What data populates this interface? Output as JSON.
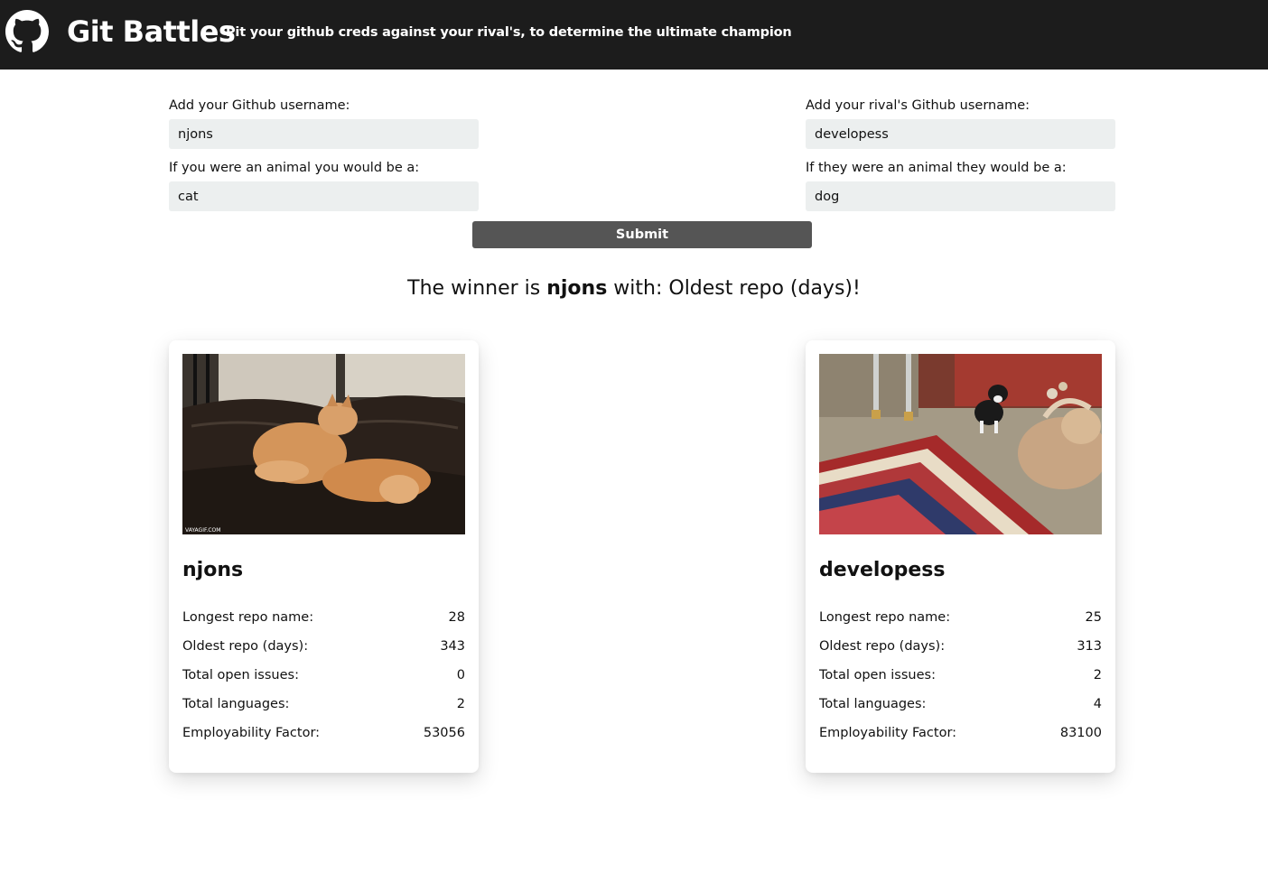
{
  "header": {
    "title": "Git Battles",
    "tagline": "Pit your github creds against your rival's, to determine the ultimate champion",
    "logo_icon": "github-octocat-icon"
  },
  "form": {
    "left": {
      "username_label": "Add your Github username:",
      "username_value": "njons",
      "animal_label": "If you were an animal you would be a:",
      "animal_value": "cat"
    },
    "right": {
      "username_label": "Add your rival's Github username:",
      "username_value": "developess",
      "animal_label": "If they were an animal they would be a:",
      "animal_value": "dog"
    },
    "submit_label": "Submit"
  },
  "result": {
    "prefix": "The winner is ",
    "winner": "njons",
    "middle": " with: ",
    "category": "Oldest repo (days)",
    "suffix": "!"
  },
  "cards": [
    {
      "name": "njons",
      "image_watermark": "VAYAGIF.COM",
      "stats": [
        {
          "label": "Longest repo name:",
          "value": "28"
        },
        {
          "label": "Oldest repo (days):",
          "value": "343"
        },
        {
          "label": "Total open issues:",
          "value": "0"
        },
        {
          "label": "Total languages:",
          "value": "2"
        },
        {
          "label": "Employability Factor:",
          "value": "53056"
        }
      ]
    },
    {
      "name": "developess",
      "stats": [
        {
          "label": "Longest repo name:",
          "value": "25"
        },
        {
          "label": "Oldest repo (days):",
          "value": "313"
        },
        {
          "label": "Total open issues:",
          "value": "2"
        },
        {
          "label": "Total languages:",
          "value": "4"
        },
        {
          "label": "Employability Factor:",
          "value": "83100"
        }
      ]
    }
  ],
  "colors": {
    "header_bg": "#1c1c1c",
    "input_bg": "#ecefef",
    "button_bg": "#555555"
  }
}
